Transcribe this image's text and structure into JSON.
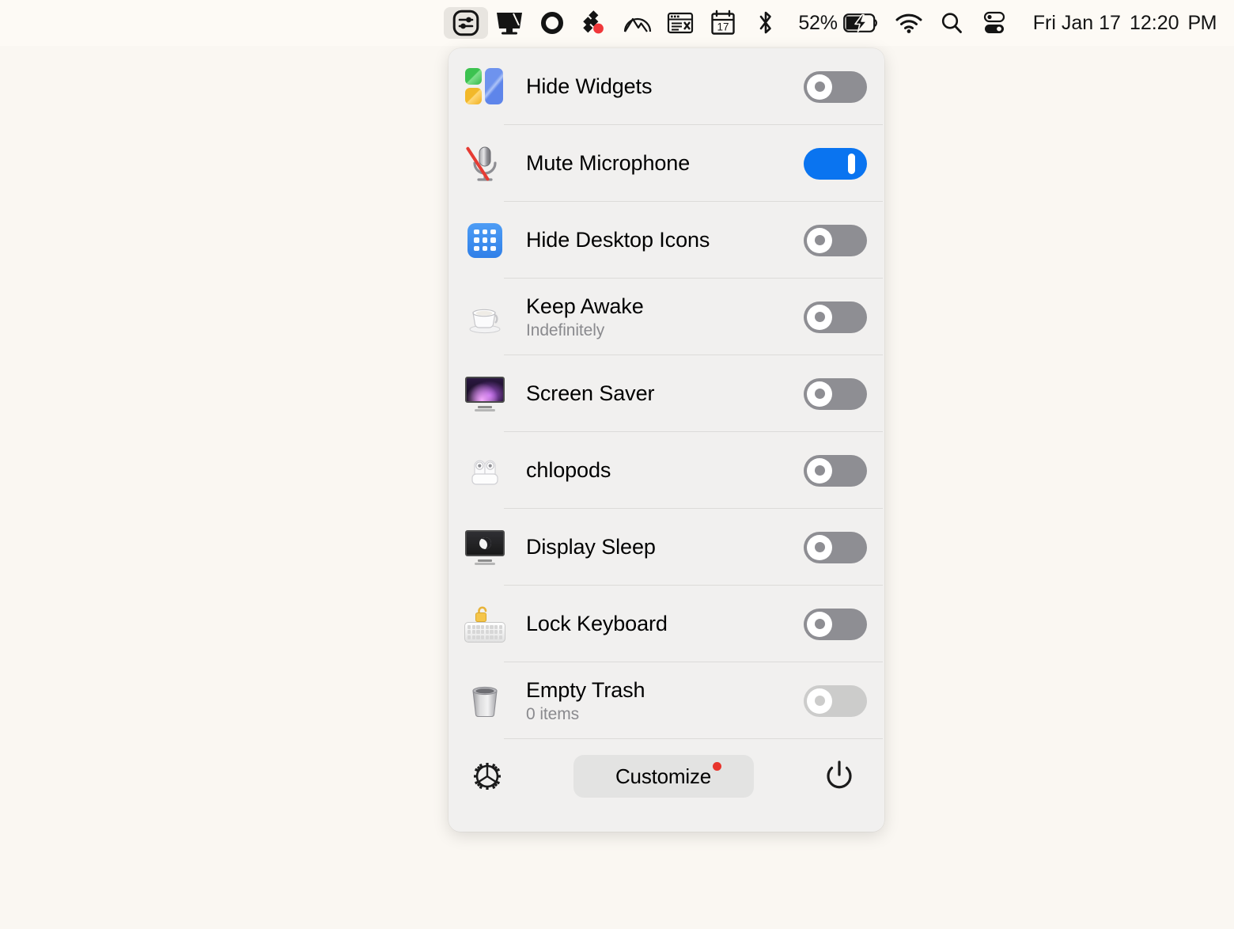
{
  "desktop": {
    "background_color": "#faf7f2"
  },
  "menubar": {
    "background_color": "#fdfaf5",
    "items": [
      {
        "name": "one-switch-app-icon",
        "icon": "sliders-rounded-square-icon",
        "active": true
      },
      {
        "name": "display-menu-icon",
        "icon": "monitor-icon",
        "active": false
      },
      {
        "name": "ring-status-icon",
        "icon": "circle-ring-icon",
        "active": false
      },
      {
        "name": "dropbox-icon",
        "icon": "diamond-cluster-icon",
        "active": false
      },
      {
        "name": "nordvpn-icon",
        "icon": "mountain-arc-icon",
        "active": false
      },
      {
        "name": "text-window-icon",
        "icon": "window-text-icon",
        "active": false
      },
      {
        "name": "calendar-icon",
        "icon": "calendar-17-icon",
        "active": false
      },
      {
        "name": "bluetooth-icon",
        "icon": "bluetooth-icon",
        "active": false
      }
    ],
    "battery": {
      "percent_label": "52%",
      "charging": true
    },
    "wifi": {
      "icon": "wifi-icon"
    },
    "search": {
      "icon": "search-icon"
    },
    "control_center": {
      "icon": "control-center-icon"
    },
    "clock": {
      "date": "Fri Jan 17",
      "time": "12:20",
      "ampm": "PM"
    }
  },
  "panel": {
    "background_color": "#f1f0ef",
    "accent_color": "#0a74f0",
    "off_color": "#8e8e93",
    "rows": [
      {
        "id": "hide-widgets",
        "icon": "widgets-icon",
        "title": "Hide Widgets",
        "subtitle": "",
        "toggle": "off"
      },
      {
        "id": "mute-microphone",
        "icon": "mic-muted-icon",
        "title": "Mute Microphone",
        "subtitle": "",
        "toggle": "on"
      },
      {
        "id": "hide-desktop-icons",
        "icon": "desktop-grid-icon",
        "title": "Hide Desktop Icons",
        "subtitle": "",
        "toggle": "off"
      },
      {
        "id": "keep-awake",
        "icon": "coffee-cup-icon",
        "title": "Keep Awake",
        "subtitle": "Indefinitely",
        "toggle": "off"
      },
      {
        "id": "screen-saver",
        "icon": "screen-saver-icon",
        "title": "Screen Saver",
        "subtitle": "",
        "toggle": "off"
      },
      {
        "id": "chlopods",
        "icon": "airpods-icon",
        "title": "chlopods",
        "subtitle": "",
        "toggle": "off"
      },
      {
        "id": "display-sleep",
        "icon": "display-sleep-icon",
        "title": "Display Sleep",
        "subtitle": "",
        "toggle": "off"
      },
      {
        "id": "lock-keyboard",
        "icon": "keyboard-lock-icon",
        "title": "Lock Keyboard",
        "subtitle": "",
        "toggle": "off"
      },
      {
        "id": "empty-trash",
        "icon": "trash-icon",
        "title": "Empty Trash",
        "subtitle": "0 items",
        "toggle": "disabled"
      }
    ],
    "footer": {
      "settings_icon": "gear-icon",
      "customize_label": "Customize",
      "customize_badge": true,
      "power_icon": "power-icon"
    }
  }
}
